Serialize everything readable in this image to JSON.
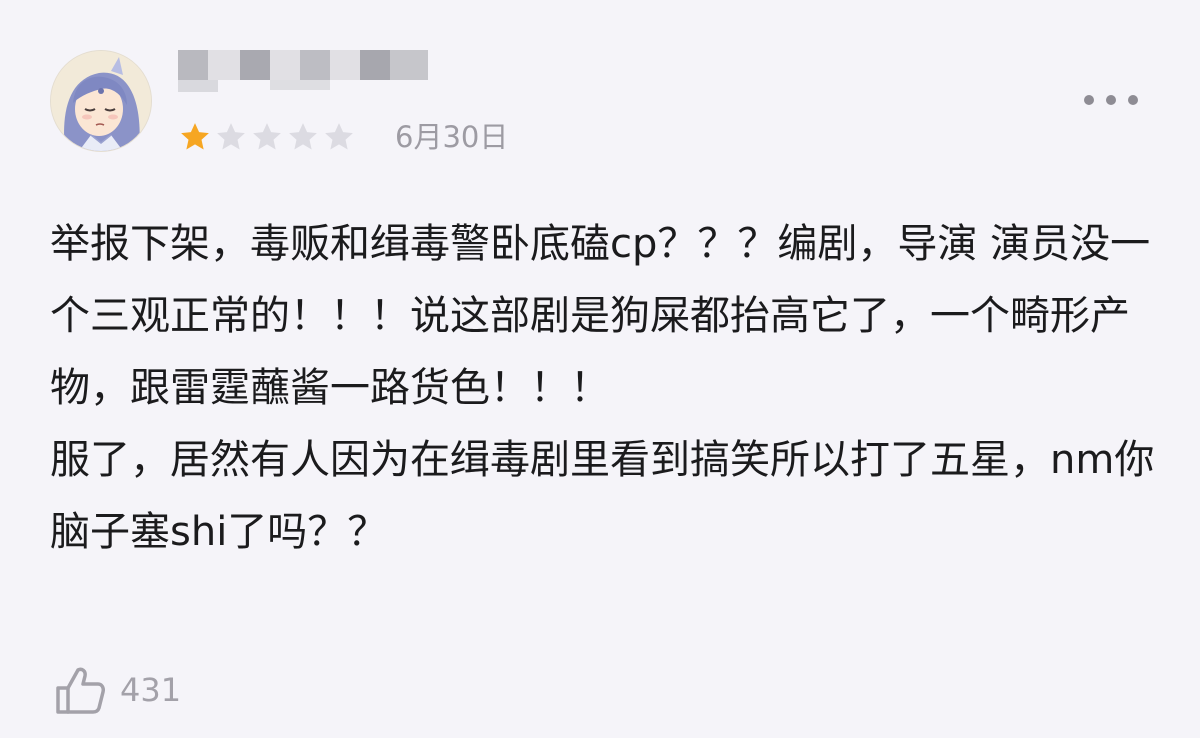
{
  "review": {
    "rating": 1,
    "rating_max": 5,
    "date": "6月30日",
    "paragraphs": [
      "举报下架，毒贩和缉毒警卧底磕cp？？？编剧，导演 演员没一个三观正常的！！！说这部剧是狗屎都抬高它了，一个畸形产物，跟雷霆蘸酱一路货色！！！",
      "服了，居然有人因为在缉毒剧里看到搞笑所以打了五星，nm你脑子塞shi了吗？？"
    ],
    "likes": "431"
  },
  "icons": {
    "star_filled": "star-filled-icon",
    "star_empty": "star-empty-icon",
    "more": "more-icon",
    "like": "thumbs-up-icon"
  },
  "colors": {
    "background": "#f5f4f9",
    "star_filled": "#f6a623",
    "star_empty": "#dcdbe2",
    "text": "#1b1b1d",
    "muted": "#9d9ba3"
  }
}
